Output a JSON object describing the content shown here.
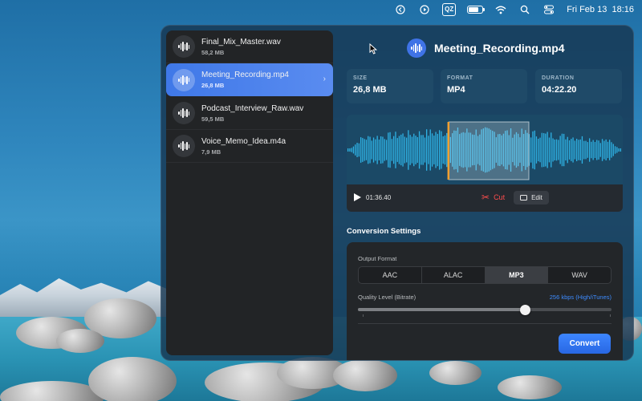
{
  "menubar": {
    "icons": [
      "back-circle-icon",
      "play-circle-icon",
      "qz-icon",
      "battery-icon",
      "wifi-icon",
      "search-icon",
      "control-center-icon"
    ],
    "qz_label": "QZ",
    "battery_level": 0.75,
    "date": "Fri Feb 13",
    "time": "18:16"
  },
  "files": [
    {
      "name": "Final_Mix_Master.wav",
      "size": "58,2 MB",
      "selected": false
    },
    {
      "name": "Meeting_Recording.mp4",
      "size": "26,8 MB",
      "selected": true
    },
    {
      "name": "Podcast_Interview_Raw.wav",
      "size": "59,5 MB",
      "selected": false
    },
    {
      "name": "Voice_Memo_Idea.m4a",
      "size": "7,9 MB",
      "selected": false
    }
  ],
  "detail": {
    "title": "Meeting_Recording.mp4",
    "stats": [
      {
        "label": "SIZE",
        "value": "26,8 MB"
      },
      {
        "label": "FORMAT",
        "value": "MP4"
      },
      {
        "label": "DURATION",
        "value": "04:22.20"
      }
    ]
  },
  "waveform": {
    "wave_color": "#2fb3e6",
    "selection_start_fraction": 0.37,
    "selection_end_fraction": 0.66,
    "playhead_fraction": 0.365
  },
  "player": {
    "current_time": "01:36.40",
    "cut_label": "Cut",
    "edit_label": "Edit"
  },
  "conversion": {
    "section_title": "Conversion Settings",
    "output_format_label": "Output Format",
    "formats": [
      "AAC",
      "ALAC",
      "MP3",
      "WAV"
    ],
    "selected_format": "MP3",
    "quality_label": "Quality Level (Bitrate)",
    "bitrate_value": "256 kbps (High/iTunes)",
    "quality_fraction": 0.66,
    "convert_label": "Convert"
  },
  "colors": {
    "accent": "#3f78e8",
    "cut_red": "#ff4d4d",
    "bitrate_blue": "#3e8cff"
  }
}
